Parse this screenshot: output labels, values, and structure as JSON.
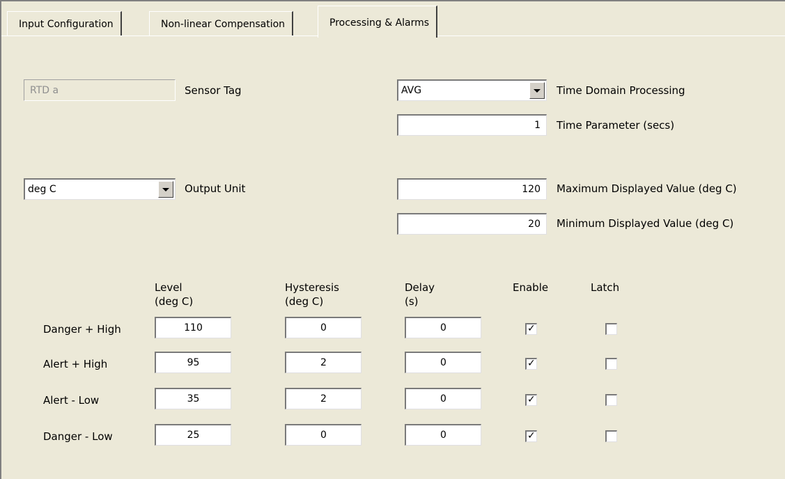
{
  "tabs": [
    {
      "label": "Input Configuration",
      "active": false
    },
    {
      "label": "Non-linear Compensation",
      "active": false
    },
    {
      "label": "Processing & Alarms",
      "active": true
    }
  ],
  "sensor_tag": {
    "value": "RTD a",
    "label": "Sensor Tag"
  },
  "time_domain": {
    "selected": "AVG",
    "label": "Time Domain Processing"
  },
  "time_parameter": {
    "value": "1",
    "label": "Time Parameter (secs)"
  },
  "output_unit": {
    "selected": "deg C",
    "label": "Output Unit"
  },
  "max_displayed": {
    "value": "120",
    "label": "Maximum Displayed Value (deg C)"
  },
  "min_displayed": {
    "value": "20",
    "label": "Minimum Displayed Value (deg C)"
  },
  "alarm_headers": {
    "level": [
      "Level",
      "(deg C)"
    ],
    "hysteresis": [
      "Hysteresis",
      "(deg C)"
    ],
    "delay": [
      "Delay",
      "(s)"
    ],
    "enable": "Enable",
    "latch": "Latch"
  },
  "alarms": [
    {
      "name": "Danger + High",
      "level": "110",
      "hysteresis": "0",
      "delay": "0",
      "enable": true,
      "latch": false
    },
    {
      "name": "Alert + High",
      "level": "95",
      "hysteresis": "2",
      "delay": "0",
      "enable": true,
      "latch": false
    },
    {
      "name": "Alert - Low",
      "level": "35",
      "hysteresis": "2",
      "delay": "0",
      "enable": true,
      "latch": false
    },
    {
      "name": "Danger - Low",
      "level": "25",
      "hysteresis": "0",
      "delay": "0",
      "enable": true,
      "latch": false
    }
  ]
}
